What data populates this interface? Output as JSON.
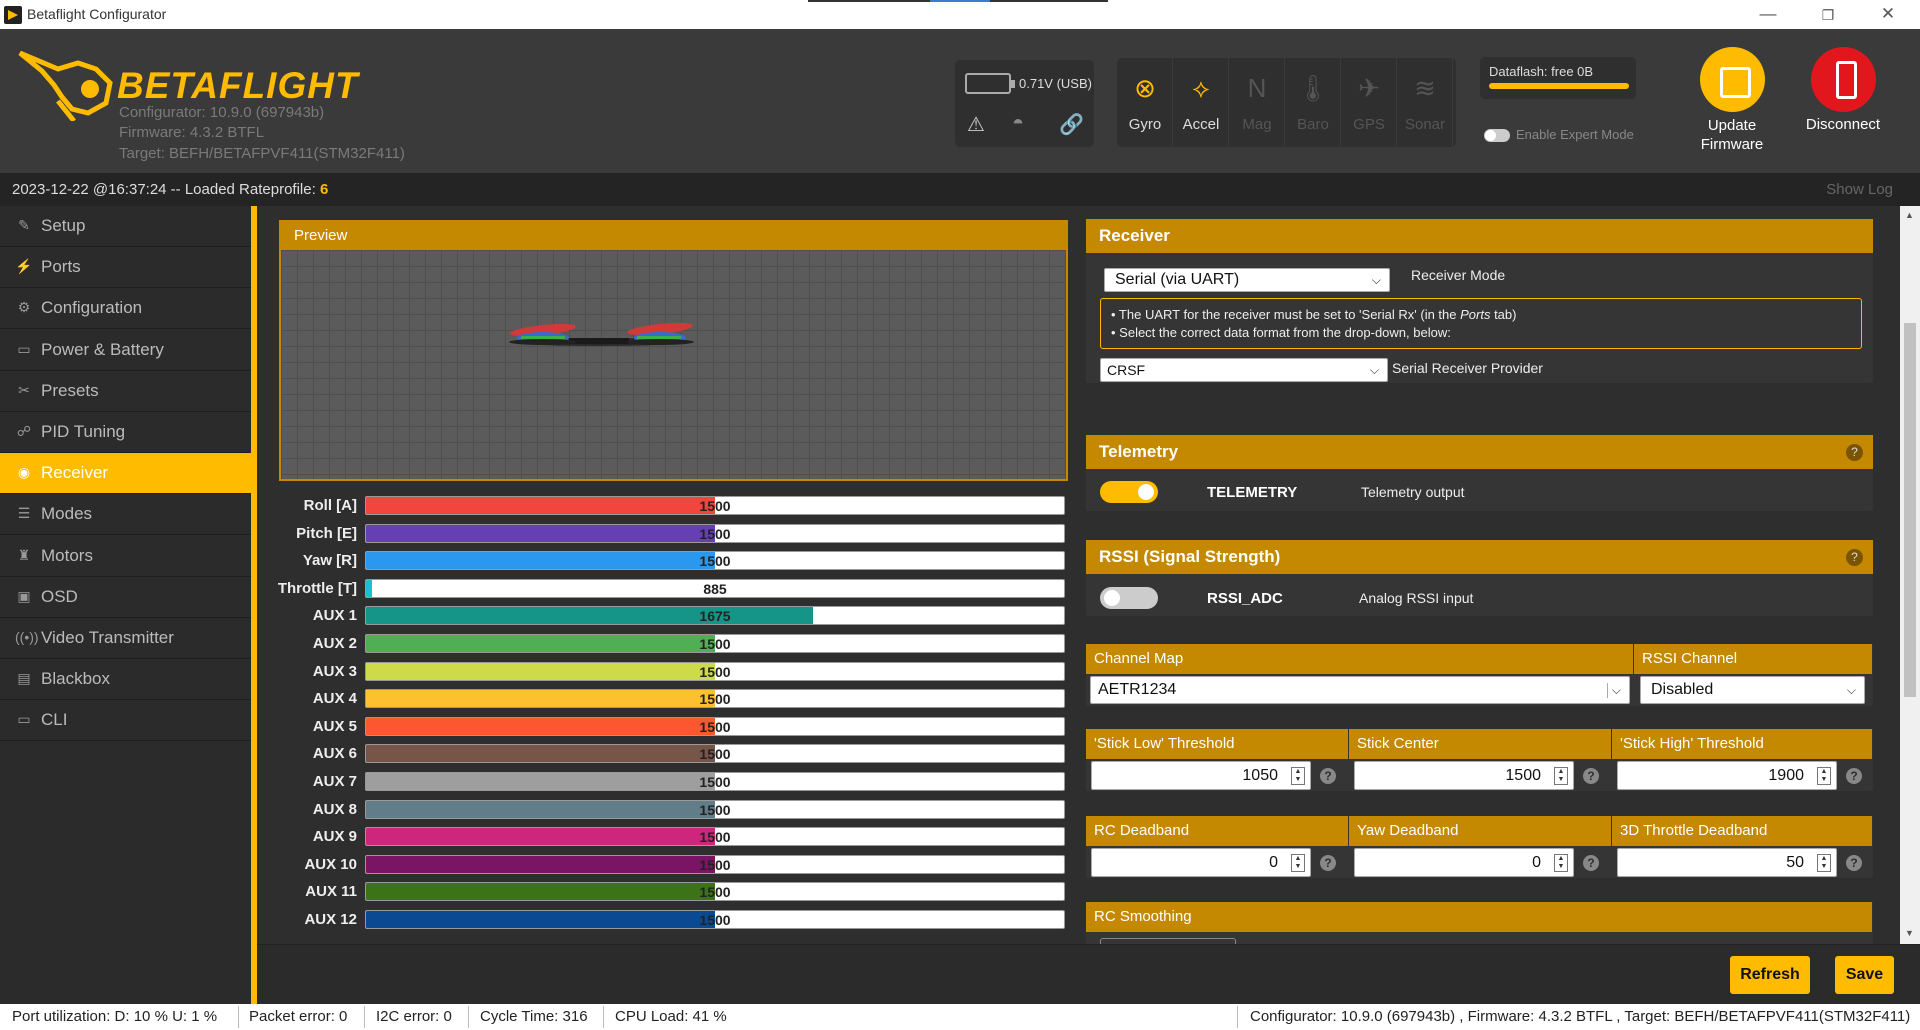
{
  "window": {
    "title": "Betaflight Configurator",
    "minimize": "—",
    "restore": "❐",
    "close": "✕"
  },
  "header": {
    "logo_text": "BETAFLIGHT",
    "configurator_version": "Configurator: 10.9.0 (697943b)",
    "firmware": "Firmware: 4.3.2 BTFL",
    "target": "Target: BEFH/BETAFPVF411(STM32F411)",
    "battery": "0.71V (USB)",
    "sensors": [
      {
        "label": "Gyro",
        "icon": "gyro-icon",
        "glyph": "⊗",
        "active": true
      },
      {
        "label": "Accel",
        "icon": "accel-icon",
        "glyph": "⟡",
        "active": true
      },
      {
        "label": "Mag",
        "icon": "mag-icon",
        "glyph": "N",
        "active": false
      },
      {
        "label": "Baro",
        "icon": "baro-icon",
        "glyph": "🌡",
        "active": false
      },
      {
        "label": "GPS",
        "icon": "gps-icon",
        "glyph": "✈",
        "active": false
      },
      {
        "label": "Sonar",
        "icon": "sonar-icon",
        "glyph": "≋",
        "active": false
      }
    ],
    "dataflash": "Dataflash: free 0B",
    "expert_mode": "Enable Expert Mode",
    "update_firmware": "Update Firmware",
    "disconnect": "Disconnect"
  },
  "log": {
    "message": "2023-12-22 @16:37:24 -- Loaded Rateprofile: ",
    "profile": "6",
    "show_log": "Show Log"
  },
  "sidebar": {
    "items": [
      {
        "label": "Setup",
        "icon": "wrench-icon",
        "glyph": "✎"
      },
      {
        "label": "Ports",
        "icon": "plug-icon",
        "glyph": "⚡"
      },
      {
        "label": "Configuration",
        "icon": "gear-icon",
        "glyph": "⚙"
      },
      {
        "label": "Power & Battery",
        "icon": "battery-icon",
        "glyph": "▭"
      },
      {
        "label": "Presets",
        "icon": "presets-icon",
        "glyph": "✂"
      },
      {
        "label": "PID Tuning",
        "icon": "pid-icon",
        "glyph": "☍"
      },
      {
        "label": "Receiver",
        "icon": "receiver-icon",
        "glyph": "◉"
      },
      {
        "label": "Modes",
        "icon": "modes-icon",
        "glyph": "☰"
      },
      {
        "label": "Motors",
        "icon": "motor-icon",
        "glyph": "♜"
      },
      {
        "label": "OSD",
        "icon": "osd-icon",
        "glyph": "▣"
      },
      {
        "label": "Video Transmitter",
        "icon": "vtx-icon",
        "glyph": "((•))"
      },
      {
        "label": "Blackbox",
        "icon": "blackbox-icon",
        "glyph": "▤"
      },
      {
        "label": "CLI",
        "icon": "cli-icon",
        "glyph": "▭"
      }
    ],
    "active_index": 6
  },
  "preview": {
    "title": "Preview"
  },
  "channels": [
    {
      "label": "Roll [A]",
      "value": 1500,
      "color": "#f1453d"
    },
    {
      "label": "Pitch [E]",
      "value": 1500,
      "color": "#673fb4"
    },
    {
      "label": "Yaw [R]",
      "value": 1500,
      "color": "#2b98f0"
    },
    {
      "label": "Throttle [T]",
      "value": 885,
      "color": "#1fbcd2"
    },
    {
      "label": "AUX 1",
      "value": 1675,
      "color": "#159588"
    },
    {
      "label": "AUX 2",
      "value": 1500,
      "color": "#50ae55"
    },
    {
      "label": "AUX 3",
      "value": 1500,
      "color": "#cdda49"
    },
    {
      "label": "AUX 4",
      "value": 1500,
      "color": "#fdc02f"
    },
    {
      "label": "AUX 5",
      "value": 1500,
      "color": "#fc5830"
    },
    {
      "label": "AUX 6",
      "value": 1500,
      "color": "#785549"
    },
    {
      "label": "AUX 7",
      "value": 1500,
      "color": "#9e9e9e"
    },
    {
      "label": "AUX 8",
      "value": 1500,
      "color": "#617d8a"
    },
    {
      "label": "AUX 9",
      "value": 1500,
      "color": "#cf267d"
    },
    {
      "label": "AUX 10",
      "value": 1500,
      "color": "#7a1464"
    },
    {
      "label": "AUX 11",
      "value": 1500,
      "color": "#3c7317"
    },
    {
      "label": "AUX 12",
      "value": 1500,
      "color": "#0b4a93"
    }
  ],
  "channel_range": [
    875,
    2125
  ],
  "receiver": {
    "title": "Receiver",
    "mode_value": "Serial (via UART)",
    "mode_label": "Receiver Mode",
    "info_line1": "• The UART for the receiver must be set to 'Serial Rx' (in the ",
    "info_ports": "Ports",
    "info_line1_end": " tab)",
    "info_line2": "• Select the correct data format from the drop-down, below:",
    "provider_value": "CRSF",
    "provider_label": "Serial Receiver Provider"
  },
  "telemetry": {
    "title": "Telemetry",
    "feature": "TELEMETRY",
    "desc": "Telemetry output",
    "enabled": true
  },
  "rssi": {
    "title": "RSSI (Signal Strength)",
    "feature": "RSSI_ADC",
    "desc": "Analog RSSI input",
    "enabled": false
  },
  "channel_map": {
    "label": "Channel Map",
    "value": "AETR1234",
    "rssi_label": "RSSI Channel",
    "rssi_value": "Disabled"
  },
  "thresholds": [
    {
      "label": "'Stick Low' Threshold",
      "value": "1050"
    },
    {
      "label": "Stick Center",
      "value": "1500"
    },
    {
      "label": "'Stick High' Threshold",
      "value": "1900"
    }
  ],
  "deadbands": [
    {
      "label": "RC Deadband",
      "value": "0"
    },
    {
      "label": "Yaw Deadband",
      "value": "0"
    },
    {
      "label": "3D Throttle Deadband",
      "value": "50"
    }
  ],
  "rc_smoothing": {
    "title": "RC Smoothing"
  },
  "buttons": {
    "refresh": "Refresh",
    "save": "Save"
  },
  "status": {
    "port_util": "Port utilization: D: 10 % U: 1 %",
    "packet_error": "Packet error: 0",
    "i2c_error": "I2C error: 0",
    "cycle_time": "Cycle Time: 316",
    "cpu_load": "CPU Load: 41 %",
    "version": "Configurator: 10.9.0 (697943b) , Firmware: 4.3.2 BTFL , Target: BEFH/BETAFPVF411(STM32F411)"
  }
}
